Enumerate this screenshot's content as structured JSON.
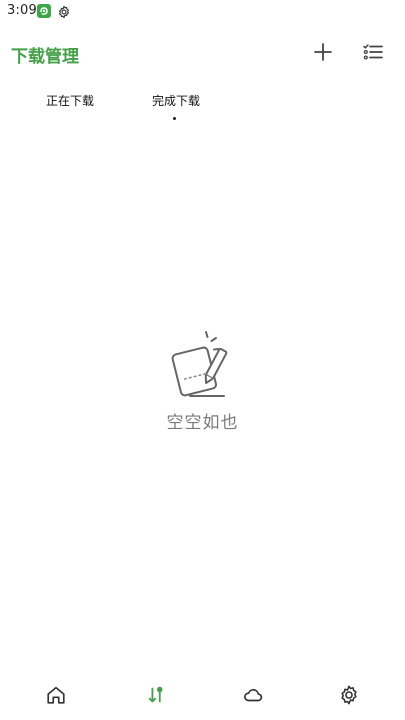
{
  "status_bar": {
    "time": "3:09"
  },
  "header": {
    "title": "下载管理"
  },
  "tabs": [
    {
      "label": "正在下载"
    },
    {
      "label": "完成下载"
    }
  ],
  "empty_state": {
    "message": "空空如也"
  },
  "bottom_nav": {
    "items": [
      "home-icon",
      "transfer-icon",
      "cloud-icon",
      "settings-icon"
    ],
    "active_color": "#43a047"
  },
  "colors": {
    "accent": "#43a047",
    "icon": "#444444",
    "muted_text": "#7a7a7a"
  }
}
